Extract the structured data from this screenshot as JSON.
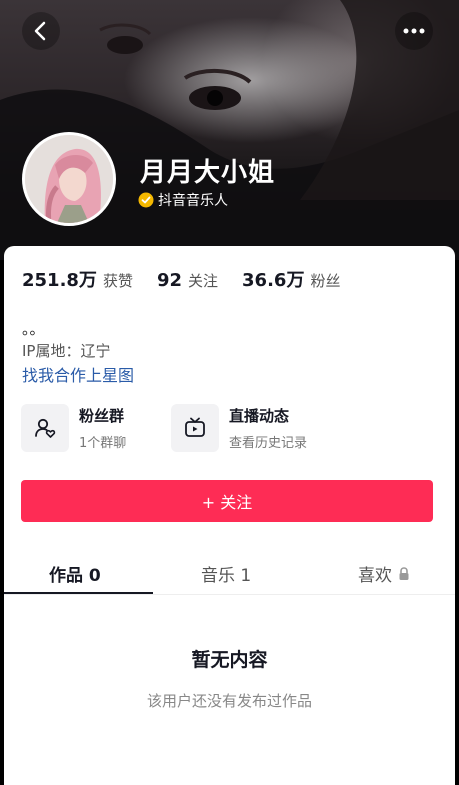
{
  "header": {
    "back_icon": "chevron-left-icon",
    "more_icon": "more-horizontal-icon"
  },
  "profile": {
    "name": "月月大小姐",
    "badge": "抖音音乐人",
    "badge_color": "#f5b800"
  },
  "stats": [
    {
      "value": "251.8万",
      "label": "获赞"
    },
    {
      "value": "92",
      "label": "关注"
    },
    {
      "value": "36.6万",
      "label": "粉丝"
    }
  ],
  "bio": "。。",
  "ip_location": "IP属地：辽宁",
  "link_text": "找我合作上星图",
  "features": [
    {
      "title": "粉丝群",
      "subtitle": "1个群聊",
      "icon": "fan-group-icon"
    },
    {
      "title": "直播动态",
      "subtitle": "查看历史记录",
      "icon": "live-tv-icon"
    }
  ],
  "follow_button": "+ 关注",
  "accent_color": "#fe2c55",
  "tabs": [
    {
      "label": "作品 0"
    },
    {
      "label": "音乐 1"
    },
    {
      "label": "喜欢",
      "icon": "lock-icon"
    }
  ],
  "empty_state": {
    "title": "暂无内容",
    "subtitle": "该用户还没有发布过作品"
  }
}
